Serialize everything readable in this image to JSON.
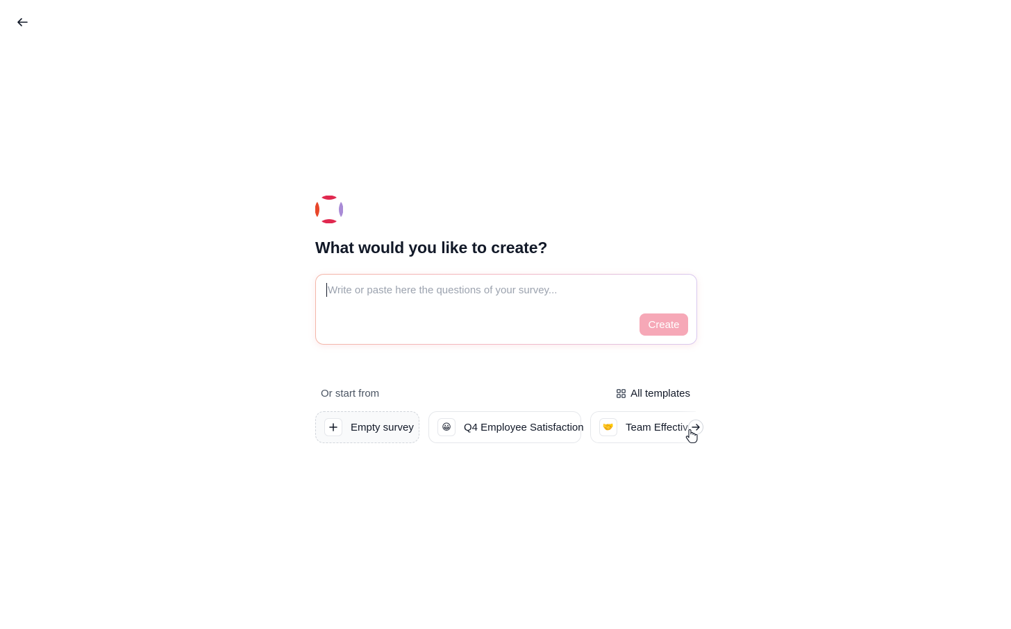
{
  "header": {
    "back_icon": "arrow-left-icon"
  },
  "brand": {
    "logo_icon": "brand-logo-icon",
    "colors": [
      "#e8462a",
      "#e0284f",
      "#a98bd6"
    ]
  },
  "main": {
    "title": "What would you like to create?",
    "prompt": {
      "placeholder": "Write or paste here the questions of your survey...",
      "value": ""
    },
    "create_label": "Create",
    "create_color": "#f6a8b7"
  },
  "templates": {
    "start_label": "Or start from",
    "all_label": "All templates",
    "all_icon": "grid-icon",
    "cards": [
      {
        "label": "Empty survey",
        "icon": "plus-icon",
        "glyph": "+"
      },
      {
        "label": "Q4 Employee Satisfaction",
        "icon": "smile-emoji-icon",
        "glyph": "😀"
      },
      {
        "label": "Team Effectiveness",
        "icon": "handshake-emoji-icon",
        "glyph": "🤝"
      }
    ],
    "next_icon": "arrow-right-icon"
  }
}
